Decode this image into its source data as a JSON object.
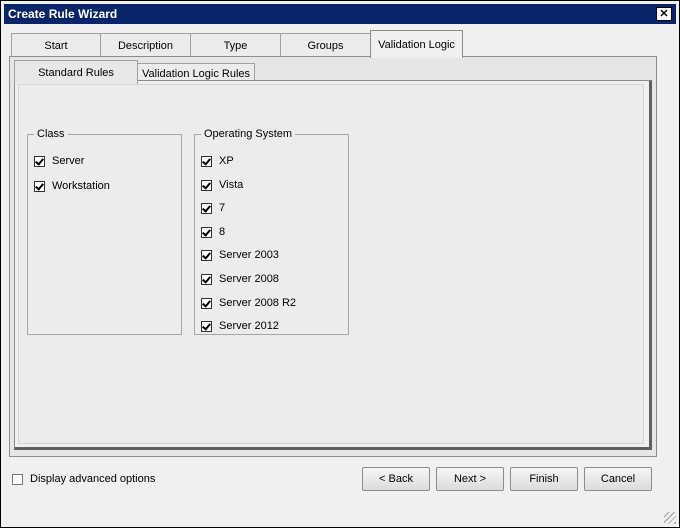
{
  "window": {
    "title": "Create Rule Wizard",
    "close_glyph": "✕"
  },
  "tabs": [
    {
      "label": "Start"
    },
    {
      "label": "Description"
    },
    {
      "label": "Type"
    },
    {
      "label": "Groups"
    },
    {
      "label": "Validation Logic",
      "active": true
    }
  ],
  "subtabs": [
    {
      "label": "Standard Rules",
      "active": true
    },
    {
      "label": "Validation Logic Rules"
    }
  ],
  "class_group": {
    "legend": "Class",
    "items": [
      {
        "label": "Server",
        "checked": true
      },
      {
        "label": "Workstation",
        "checked": true
      }
    ]
  },
  "os_group": {
    "legend": "Operating System",
    "items": [
      {
        "label": "XP",
        "checked": true
      },
      {
        "label": "Vista",
        "checked": true
      },
      {
        "label": "7",
        "checked": true
      },
      {
        "label": "8",
        "checked": true
      },
      {
        "label": "Server 2003",
        "checked": true
      },
      {
        "label": "Server 2008",
        "checked": true
      },
      {
        "label": "Server 2008 R2",
        "checked": true
      },
      {
        "label": "Server 2012",
        "checked": true
      }
    ]
  },
  "footer": {
    "advanced_label": "Display advanced options",
    "advanced_checked": false,
    "back_label": "< Back",
    "next_label": "Next >",
    "finish_label": "Finish",
    "cancel_label": "Cancel"
  }
}
